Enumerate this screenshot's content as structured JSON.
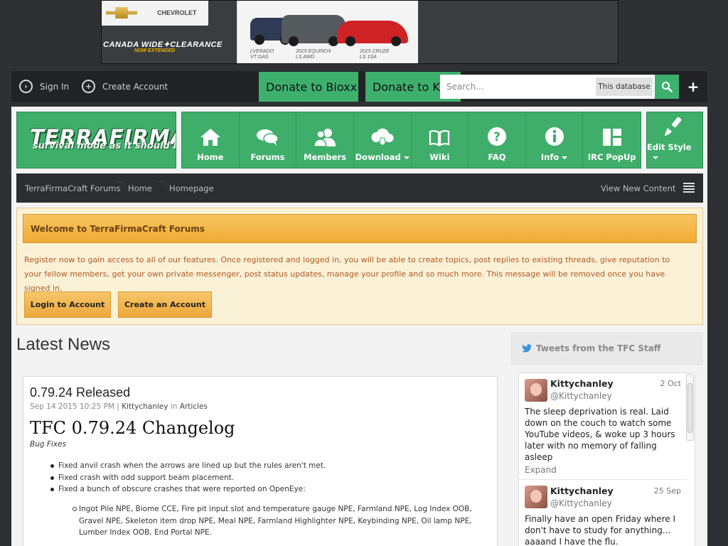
{
  "ad": {
    "brand": "CHEVROLET",
    "headline": "CANADA WIDE✦CLEARANCE",
    "subline": "NOW EXTENDED",
    "car_labels": [
      "LVERADO\nVT GAS",
      "2015 EQUINOX\nLS AWD",
      "2015 CRUZE\nLS 1SA"
    ]
  },
  "userbar": {
    "sign_in": "Sign In",
    "create_account": "Create Account",
    "donate1": "Donate to Bioxx",
    "donate2": "Donate to Kitty",
    "search_placeholder": "Search...",
    "search_scope": "This database"
  },
  "logo": {
    "title": "TERRAFIRMACRAFT",
    "tagline": "survival mode as it should be"
  },
  "nav": {
    "items": [
      {
        "label": "Home",
        "icon": "home-icon"
      },
      {
        "label": "Forums",
        "icon": "chat-icon"
      },
      {
        "label": "Members",
        "icon": "people-icon"
      },
      {
        "label": "Download",
        "icon": "cloud-download-icon"
      },
      {
        "label": "Wiki",
        "icon": "book-icon"
      },
      {
        "label": "FAQ",
        "icon": "question-icon"
      },
      {
        "label": "Info",
        "icon": "info-icon"
      },
      {
        "label": "IRC PopUp",
        "icon": "popup-icon"
      }
    ],
    "edit_style": "Edit Style"
  },
  "breadcrumb": {
    "items": [
      "TerraFirmaCraft Forums",
      "Home",
      "Homepage"
    ],
    "view_new": "View New Content"
  },
  "welcome": {
    "title": "Welcome to TerraFirmaCraft Forums",
    "text": "Register now to gain access to all of our features. Once registered and logged in, you will be able to create topics, post replies to existing threads, give reputation to your fellow members, get your own private messenger, post status updates, manage your profile and so much more. This message will be removed once you have signed in.",
    "login_btn": "Login to Account",
    "create_btn": "Create an Account"
  },
  "latest": {
    "heading": "Latest News",
    "article": {
      "title": "0.79.24 Released",
      "date": "Sep 14 2015 10:25 PM",
      "sep": "|",
      "author": "Kittychanley",
      "in_word": "in",
      "category": "Articles",
      "changelog": "TFC 0.79.24 Changelog",
      "section": "Bug Fixes",
      "bullets": [
        "Fixed anvil crash when the arrows are lined up but the rules aren't met.",
        "Fixed crash with odd support beam placement.",
        "Fixed a bunch of obscure crashes that were reported on OpenEye:"
      ],
      "sub": "Ingot Pile NPE, Biome CCE, Fire pit input slot and temperature gauge NPE, Farmland NPE, Log Index OOB, Gravel NPE, Skeleton item drop NPE, Meal NPE, Farmland Highlighter NPE, Keybinding NPE, Oil lamp NPE, Lumber Index OOB, End Portal NPE."
    }
  },
  "tweets": {
    "heading": "Tweets from the TFC Staff",
    "items": [
      {
        "name": "Kittychanley",
        "handle": "@Kittychanley",
        "date": "2 Oct",
        "text": "The sleep deprivation is real. Laid down on the couch to watch some YouTube videos, & woke up 3 hours later with no memory of falling asleep",
        "expand": "Expand"
      },
      {
        "name": "Kittychanley",
        "handle": "@Kittychanley",
        "date": "25 Sep",
        "text": "Finally have an open Friday where I don't have to study for anything... aaaand I have the flu."
      }
    ]
  },
  "colors": {
    "accent_green": "#3db06e",
    "welcome_orange": "#f0aa33",
    "topbar": "#212326"
  }
}
